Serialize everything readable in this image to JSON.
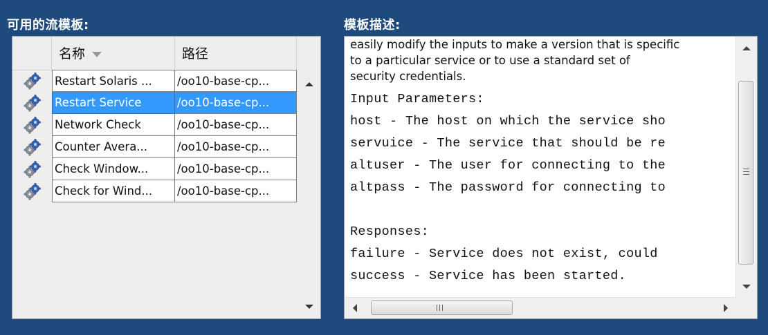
{
  "left_panel": {
    "title": "可用的流模板:",
    "columns": {
      "name": "名称",
      "path": "路径"
    },
    "rows": [
      {
        "name": "Restart Solaris ...",
        "path": "/oo10-base-cp...",
        "selected": false
      },
      {
        "name": "Restart Service",
        "path": "/oo10-base-cp...",
        "selected": true
      },
      {
        "name": "Network Check",
        "path": "/oo10-base-cp...",
        "selected": false
      },
      {
        "name": "Counter Avera...",
        "path": "/oo10-base-cp...",
        "selected": false
      },
      {
        "name": "Check Window...",
        "path": "/oo10-base-cp...",
        "selected": false
      },
      {
        "name": "Check for Wind...",
        "path": "/oo10-base-cp...",
        "selected": false
      }
    ],
    "row_icon": "gear-icon"
  },
  "right_panel": {
    "title": "模板描述:",
    "description_lines": [
      "easily modify the inputs to make a version that is specific",
      "to a particular service or to use a standard set of",
      "security credentials."
    ],
    "code_lines": [
      "Input Parameters:",
      "host - The host on which the service sho",
      "servuice - The service that should be re",
      "altuser - The user for connecting to the",
      "altpass - The password for connecting to",
      "",
      "Responses:",
      "failure - Service does not exist, could",
      "success - Service has been started."
    ]
  },
  "colors": {
    "background": "#1f4a7d",
    "selection": "#3399ff"
  }
}
